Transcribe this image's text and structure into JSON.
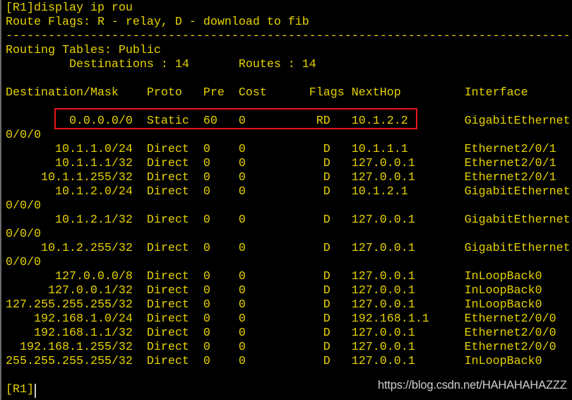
{
  "terminal": {
    "command": "[R1]display ip rou",
    "flags_legend": "Route Flags: R - relay, D - download to fib",
    "separator": "------------------------------------------------------------------------------------",
    "table_title": "Routing Tables: Public",
    "destinations_label": "Destinations : 14",
    "routes_label": "Routes : 14",
    "headers": {
      "dest": "Destination/Mask",
      "proto": "Proto",
      "pre": "Pre",
      "cost": "Cost",
      "flags": "Flags",
      "nexthop": "NextHop",
      "iface": "Interface"
    },
    "routes": [
      {
        "dest": "0.0.0.0/0",
        "proto": "Static",
        "pre": "60",
        "cost": "0",
        "flags": "RD",
        "nexthop": "10.1.2.2",
        "iface": "GigabitEthernet0/0/0",
        "highlighted": true
      },
      {
        "dest": "10.1.1.0/24",
        "proto": "Direct",
        "pre": "0",
        "cost": "0",
        "flags": "D",
        "nexthop": "10.1.1.1",
        "iface": "Ethernet2/0/1"
      },
      {
        "dest": "10.1.1.1/32",
        "proto": "Direct",
        "pre": "0",
        "cost": "0",
        "flags": "D",
        "nexthop": "127.0.0.1",
        "iface": "Ethernet2/0/1"
      },
      {
        "dest": "10.1.1.255/32",
        "proto": "Direct",
        "pre": "0",
        "cost": "0",
        "flags": "D",
        "nexthop": "127.0.0.1",
        "iface": "Ethernet2/0/1"
      },
      {
        "dest": "10.1.2.0/24",
        "proto": "Direct",
        "pre": "0",
        "cost": "0",
        "flags": "D",
        "nexthop": "10.1.2.1",
        "iface": "GigabitEthernet0/0/0"
      },
      {
        "dest": "10.1.2.1/32",
        "proto": "Direct",
        "pre": "0",
        "cost": "0",
        "flags": "D",
        "nexthop": "127.0.0.1",
        "iface": "GigabitEthernet0/0/0"
      },
      {
        "dest": "10.1.2.255/32",
        "proto": "Direct",
        "pre": "0",
        "cost": "0",
        "flags": "D",
        "nexthop": "127.0.0.1",
        "iface": "GigabitEthernet0/0/0"
      },
      {
        "dest": "127.0.0.0/8",
        "proto": "Direct",
        "pre": "0",
        "cost": "0",
        "flags": "D",
        "nexthop": "127.0.0.1",
        "iface": "InLoopBack0"
      },
      {
        "dest": "127.0.0.1/32",
        "proto": "Direct",
        "pre": "0",
        "cost": "0",
        "flags": "D",
        "nexthop": "127.0.0.1",
        "iface": "InLoopBack0"
      },
      {
        "dest": "127.255.255.255/32",
        "proto": "Direct",
        "pre": "0",
        "cost": "0",
        "flags": "D",
        "nexthop": "127.0.0.1",
        "iface": "InLoopBack0"
      },
      {
        "dest": "192.168.1.0/24",
        "proto": "Direct",
        "pre": "0",
        "cost": "0",
        "flags": "D",
        "nexthop": "192.168.1.1",
        "iface": "Ethernet2/0/0"
      },
      {
        "dest": "192.168.1.1/32",
        "proto": "Direct",
        "pre": "0",
        "cost": "0",
        "flags": "D",
        "nexthop": "127.0.0.1",
        "iface": "Ethernet2/0/0"
      },
      {
        "dest": "192.168.1.255/32",
        "proto": "Direct",
        "pre": "0",
        "cost": "0",
        "flags": "D",
        "nexthop": "127.0.0.1",
        "iface": "Ethernet2/0/0"
      },
      {
        "dest": "255.255.255.255/32",
        "proto": "Direct",
        "pre": "0",
        "cost": "0",
        "flags": "D",
        "nexthop": "127.0.0.1",
        "iface": "InLoopBack0"
      }
    ],
    "prompt": "[R1]"
  },
  "watermark": "https://blog.csdn.net/HAHAHAHAZZZ",
  "colors": {
    "text": "#e6d200",
    "background": "#000000",
    "highlight_box": "#e8141c"
  }
}
